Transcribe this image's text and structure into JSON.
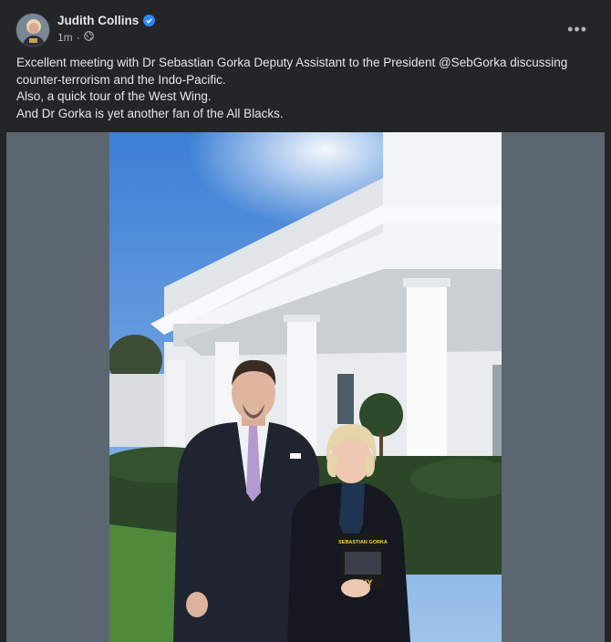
{
  "post": {
    "author": "Judith Collins",
    "timestamp": "1m",
    "more_icon": "more-horizontal-icon",
    "privacy_icon": "globe-icon",
    "verified_icon": "verified-badge-icon",
    "caption_lines": [
      "Excellent meeting with Dr Sebastian Gorka Deputy Assistant to the President @SebGorka discussing counter-terrorism and the Indo-Pacific.",
      "Also, a quick tour of the West Wing.",
      "And Dr Gorka is yet another fan of the All Blacks."
    ]
  },
  "photo": {
    "book_title_top": "SEBASTIAN GORKA",
    "book_title_bottom": "WHY"
  },
  "colors": {
    "background": "#242526",
    "text": "#e4e6eb",
    "secondary_text": "#b0b3b8",
    "verified": "#2d88ff",
    "media_letterbox": "#5c6670"
  }
}
